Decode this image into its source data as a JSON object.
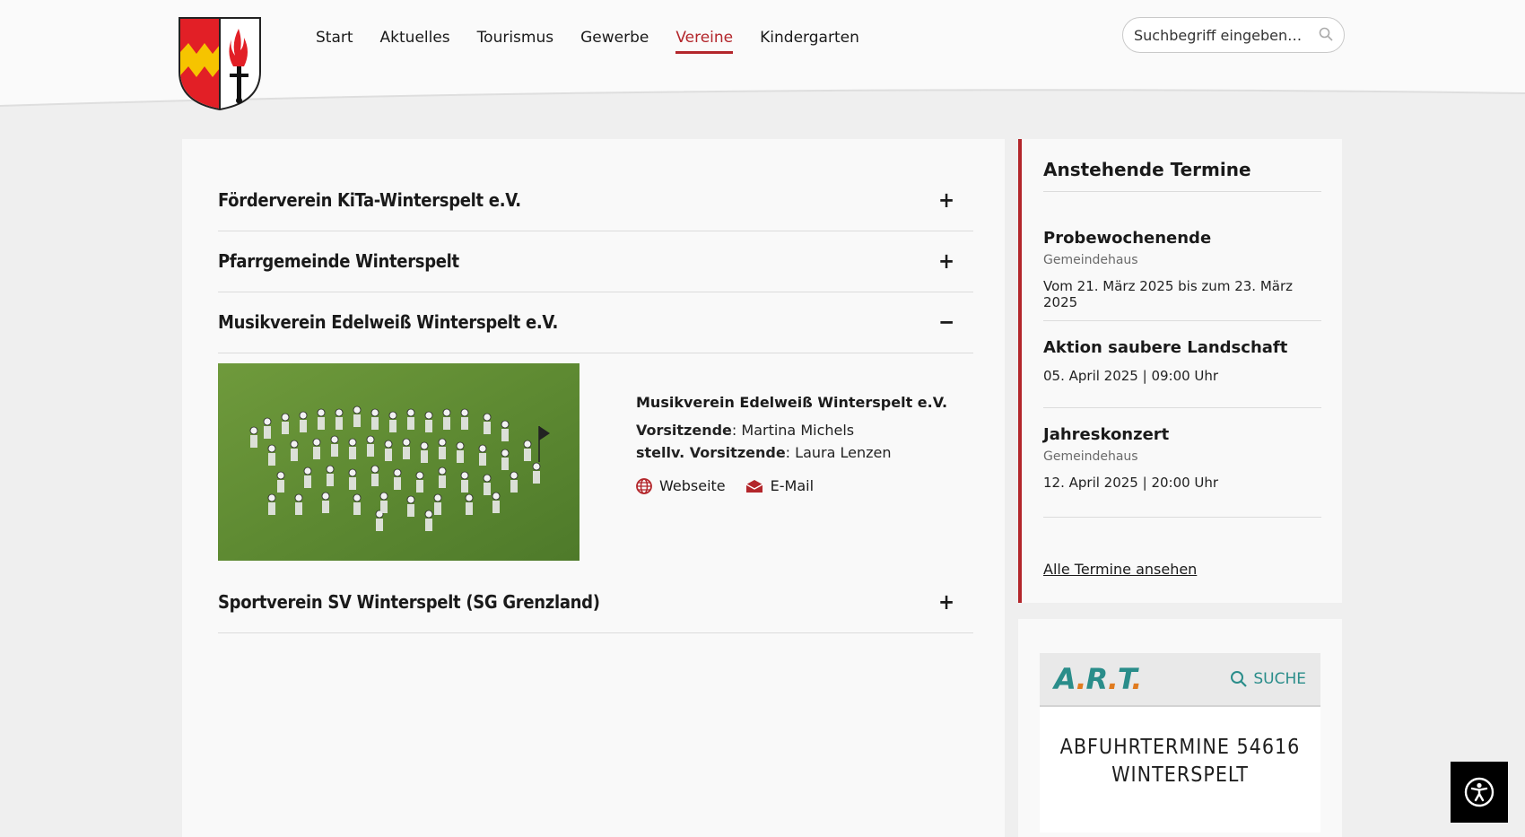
{
  "nav": {
    "items": [
      {
        "label": "Start",
        "active": false
      },
      {
        "label": "Aktuelles",
        "active": false
      },
      {
        "label": "Tourismus",
        "active": false
      },
      {
        "label": "Gewerbe",
        "active": false
      },
      {
        "label": "Vereine",
        "active": true
      },
      {
        "label": "Kindergarten",
        "active": false
      }
    ]
  },
  "search": {
    "placeholder": "Suchbegriff eingeben…"
  },
  "accordion": [
    {
      "title": "Förderverein KiTa-Winterspelt e.V.",
      "toggle": "+"
    },
    {
      "title": "Pfarrgemeinde Winterspelt",
      "toggle": "+"
    },
    {
      "title": "Musikverein Edelweiß Winterspelt e.V.",
      "toggle": "−"
    },
    {
      "title": "Sportverein SV Winterspelt (SG Grenzland)",
      "toggle": "+"
    }
  ],
  "expanded": {
    "org_name": "Musikverein Edelweiß Winterspelt e.V.",
    "chair_label": "Vorsitzende",
    "chair_value": ": Martina Michels",
    "vice_label": "stellv. Vorsitzende",
    "vice_value": ": Laura Lenzen",
    "website_label": "Webseite",
    "email_label": "E-Mail"
  },
  "events": {
    "heading": "Anstehende Termine",
    "items": [
      {
        "title": "Probewochenende",
        "location": "Gemeindehaus",
        "date": "Vom 21. März 2025 bis zum 23. März 2025"
      },
      {
        "title": "Aktion saubere Landschaft",
        "location": "",
        "date": "05. April 2025  |  09:00 Uhr"
      },
      {
        "title": "Jahreskonzert",
        "location": "Gemeindehaus",
        "date": "12. April 2025  |  20:00 Uhr"
      }
    ],
    "all_link": "Alle Termine ansehen"
  },
  "art": {
    "logo_a": "A",
    "logo_r": "R",
    "logo_t": "T",
    "search_label": "SUCHE",
    "title_line1": "ABFUHRTERMINE 54616",
    "title_line2": "WINTERSPELT"
  },
  "colors": {
    "accent": "#b3262b",
    "art_teal": "#2a8d8a",
    "art_orange": "#e07b1f"
  }
}
